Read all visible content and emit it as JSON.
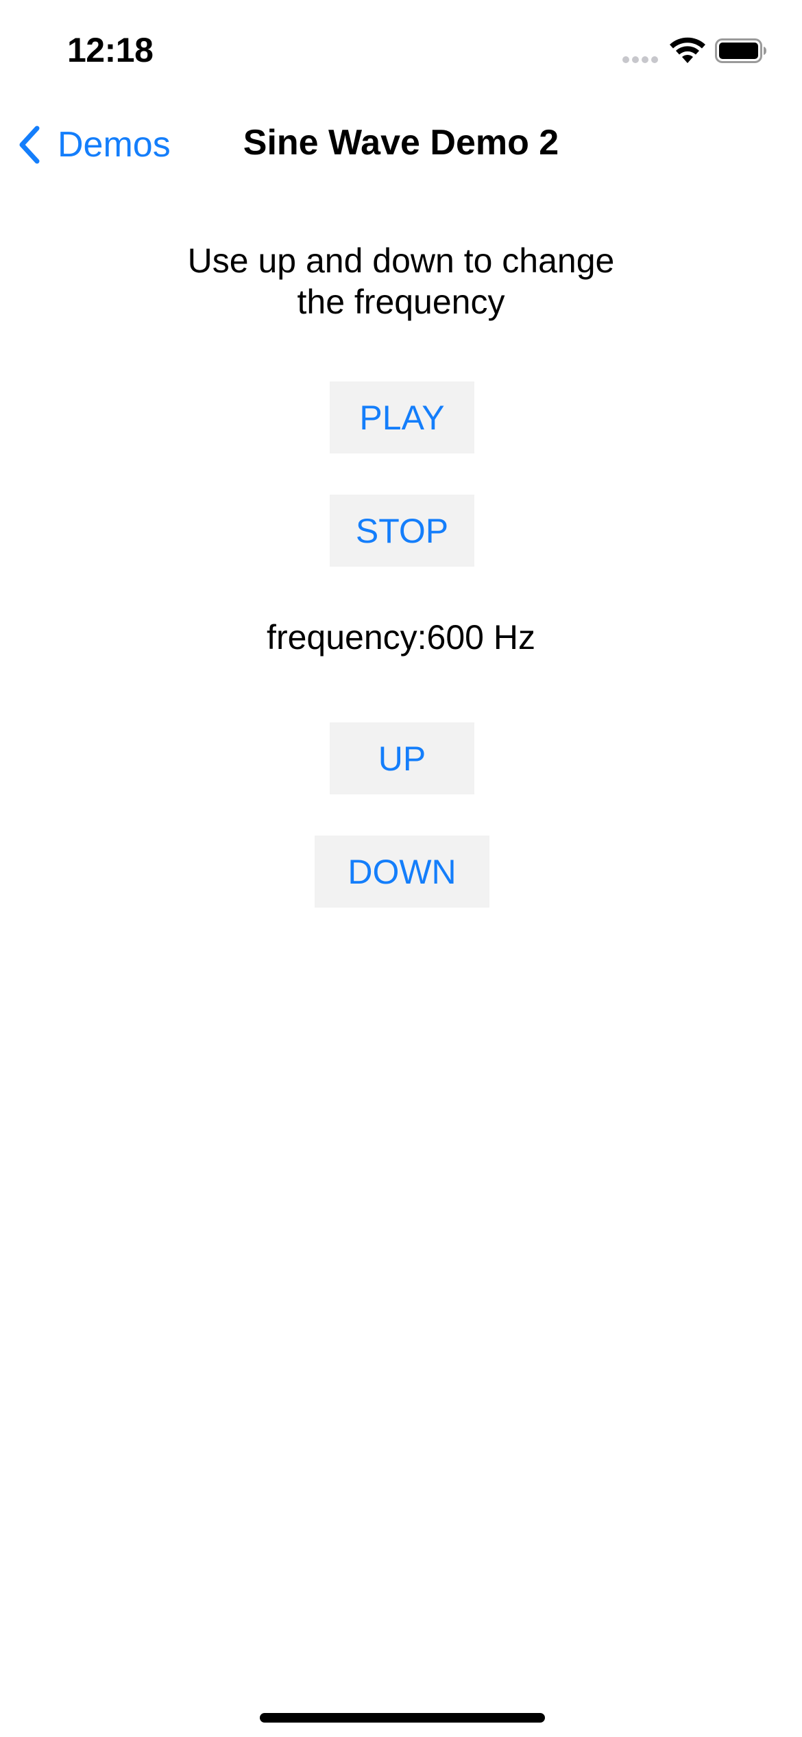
{
  "status_bar": {
    "time": "12:18"
  },
  "nav": {
    "back_label": "Demos",
    "title": "Sine Wave Demo 2"
  },
  "main": {
    "instructions_line1": "Use up and down to change",
    "instructions_line2": "the frequency",
    "play_label": "PLAY",
    "stop_label": "STOP",
    "frequency_text": "frequency:600 Hz",
    "up_label": "UP",
    "down_label": "DOWN"
  },
  "colors": {
    "accent": "#147EFB",
    "button_bg": "#F2F2F2",
    "background": "#FFFFFF"
  },
  "icons": {
    "back": "chevron-left-icon",
    "signal": "cellular-signal-icon",
    "wifi": "wifi-icon",
    "battery": "battery-icon"
  }
}
